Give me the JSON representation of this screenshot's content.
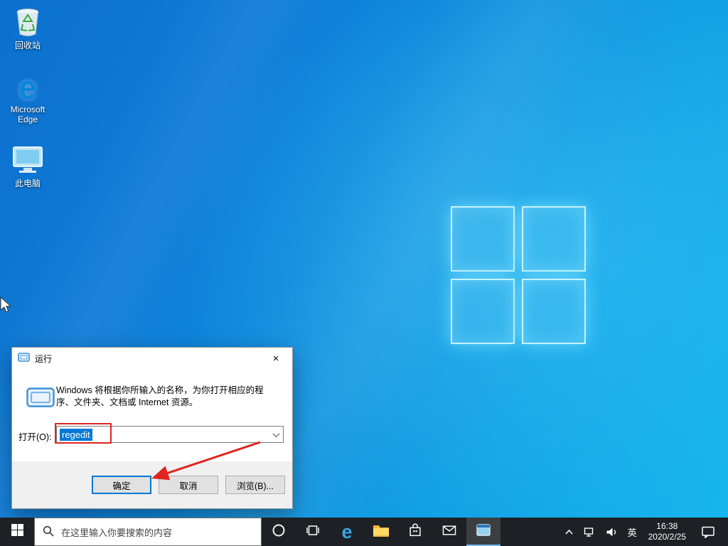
{
  "desktop": {
    "icons": [
      {
        "label": "回收站"
      },
      {
        "label": "Microsoft Edge"
      },
      {
        "label": "此电脑"
      }
    ]
  },
  "run_dialog": {
    "title": "运行",
    "close_glyph": "×",
    "description": "Windows 将根据你所输入的名称，为你打开相应的程序、文件夹、文档或 Internet 资源。",
    "open_label": "打开(O):",
    "input_value": "regedit",
    "buttons": {
      "ok": "确定",
      "cancel": "取消",
      "browse": "浏览(B)..."
    }
  },
  "taskbar": {
    "search_placeholder": "在这里输入你要搜索的内容",
    "tray": {
      "language": "英",
      "time": "16:38",
      "date": "2020/2/25"
    }
  },
  "colors": {
    "accent": "#0078d7",
    "annotation_red": "#e02420",
    "selection_blue": "#0078d7"
  }
}
